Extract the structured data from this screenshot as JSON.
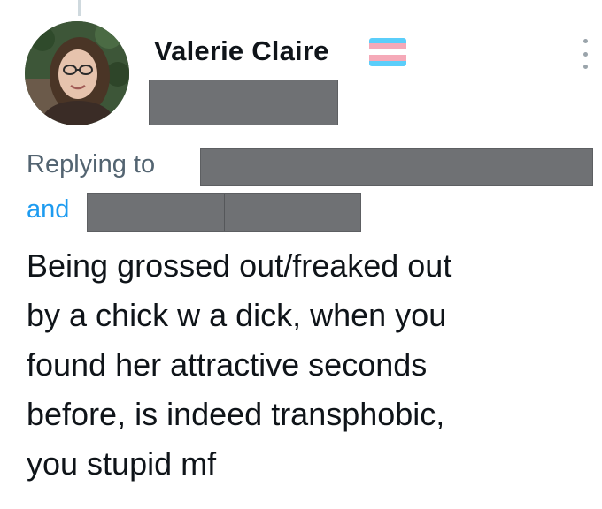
{
  "tweet": {
    "author": {
      "display_name": "Valerie Claire",
      "flag_icon": "transgender-flag-icon",
      "flag_colors": [
        "#5BCEFA",
        "#F5A9B8",
        "#FFFFFF",
        "#F5A9B8",
        "#5BCEFA"
      ]
    },
    "reply_context": {
      "replying_to_label": "Replying to",
      "and_label": "and"
    },
    "text_lines": [
      "Being grossed out/freaked out",
      "by a chick w a dick, when you",
      "found her attractive seconds",
      "before, is indeed transphobic,",
      "you stupid mf"
    ],
    "more_icon": "more-options-icon"
  },
  "colors": {
    "name_text": "#0f1419",
    "muted_text": "#536471",
    "link": "#1d9bf0",
    "redaction": "#6f7174",
    "thread_line": "#cfd9de"
  }
}
